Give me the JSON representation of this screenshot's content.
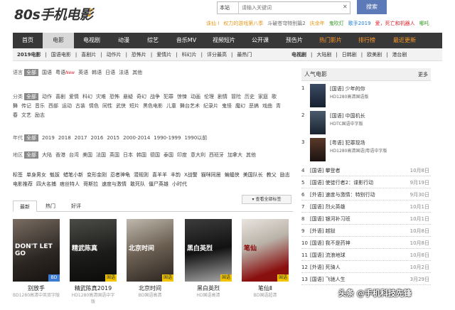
{
  "header": {
    "logo_text": "80s手机电影",
    "logo_glyph": "♪",
    "search_scope": "本站",
    "search_placeholder": "请输入关键词",
    "clear_glyph": "✕",
    "search_button": "搜索",
    "hotlinks": [
      {
        "text": "诛仙 Ⅰ",
        "color": "#e69a1a"
      },
      {
        "text": "权力的游戏第八季",
        "color": "#e69a1a"
      },
      {
        "text": "斗破苍穹特别篇2",
        "color": "#666666"
      },
      {
        "text": "庆余年",
        "color": "#e69a1a"
      },
      {
        "text": "鬼吹灯",
        "color": "#3a9a2a"
      },
      {
        "text": "歌手2019",
        "color": "#1a7ad0"
      },
      {
        "text": "爱，死亡和机器人",
        "color": "#e0232d"
      },
      {
        "text": "哪吒",
        "color": "#3a9a2a"
      }
    ]
  },
  "nav": {
    "items": [
      {
        "label": "首页"
      },
      {
        "label": "电影"
      },
      {
        "label": "电视剧"
      },
      {
        "label": "动漫"
      },
      {
        "label": "综艺"
      },
      {
        "label": "音乐MV"
      },
      {
        "label": "视频短片"
      },
      {
        "label": "公开课"
      },
      {
        "label": "预告片"
      },
      {
        "label": "热门影片"
      },
      {
        "label": "排行榜"
      },
      {
        "label": "最近更新"
      }
    ],
    "sub_left": [
      "2019电影",
      "国语电影",
      "喜剧片",
      "动作片",
      "恐怖片",
      "爱情片",
      "科幻片",
      "评分最高",
      "最热门"
    ],
    "sub_right": [
      "电视剧",
      "大陆剧",
      "日韩剧",
      "欧美剧",
      "港台剧"
    ]
  },
  "filters": {
    "language": {
      "label": "语言",
      "options": [
        "全部",
        "国语",
        "粤语",
        "英语",
        "韩语",
        "日语",
        "法语",
        "其他"
      ],
      "new_tag": "New"
    },
    "genre": {
      "label": "分类",
      "options": [
        "全部",
        "动作",
        "喜剧",
        "爱情",
        "科幻",
        "灾难",
        "恐怖",
        "悬疑",
        "奇幻",
        "战争",
        "犯罪",
        "惊悚",
        "动画",
        "伦理",
        "剧情",
        "冒险",
        "历史",
        "家庭",
        "歌舞",
        "传记",
        "音乐",
        "西部",
        "运动",
        "古装",
        "情色",
        "同性",
        "武侠",
        "短片",
        "黑色电影",
        "儿童",
        "舞台艺术",
        "纪录片",
        "鬼怪",
        "魔幻",
        "恶搞",
        "戏曲",
        "青春",
        "文艺",
        "励志"
      ]
    },
    "year": {
      "label": "年代",
      "options": [
        "全部",
        "2019",
        "2018",
        "2017",
        "2016",
        "2015",
        "2000-2014",
        "1990-1999",
        "1990以前"
      ]
    },
    "region": {
      "label": "地区",
      "options": [
        "全部",
        "大陆",
        "香港",
        "台湾",
        "美国",
        "法国",
        "英国",
        "日本",
        "韩国",
        "德国",
        "泰国",
        "印度",
        "意大利",
        "西班牙",
        "加拿大",
        "其他"
      ]
    }
  },
  "tags": {
    "label": "标签",
    "items": [
      "单身男女",
      "魁拔",
      "蜡笔小新",
      "变形金刚",
      "忍者神龟",
      "潜规则",
      "喜羊羊",
      "丰韵",
      "X战警",
      "猫咪同居",
      "蝙蝠侠",
      "美国队长",
      "教父",
      "励志电影推荐",
      "四大名捕",
      "痞丝特人",
      "哥斯拉",
      "速度与激情",
      "敢死队",
      "僵尸英雄",
      "小时代"
    ],
    "more": "查看全部标签"
  },
  "tabs": [
    "最新",
    "热门",
    "好评"
  ],
  "movies": [
    {
      "name": "别放手",
      "desc": "BD1280高清中英双字版",
      "badge": "BD",
      "poster_text": "DON'T LET GO"
    },
    {
      "name": "精武陈真2019",
      "desc": "HD1280高清国语中字版",
      "badge": "国语",
      "poster_text": "精武陈真"
    },
    {
      "name": "北京时间",
      "desc": "BD国语高清",
      "badge": "国语",
      "poster_text": "北京时间"
    },
    {
      "name": "黑白英烈",
      "desc": "HD国语高清",
      "badge": "国语",
      "poster_text": "黑白英烈"
    },
    {
      "name": "笔仙Ⅱ",
      "desc": "BD国语超清",
      "badge": "国语",
      "poster_text": "笔仙"
    }
  ],
  "sidebar": {
    "title": "人气电影",
    "more": "更多",
    "featured": [
      {
        "num": "1",
        "title": "[国语] 少年的你",
        "sub": "HD1280高清国语版"
      },
      {
        "num": "2",
        "title": "[国语] 中国机长",
        "sub": "HDTC国语中字版"
      },
      {
        "num": "3",
        "title": "[粤语] 犯罪现场",
        "sub": "HD1280高清国语|粤语中字版"
      }
    ],
    "list": [
      {
        "num": "4",
        "title": "[国语] 攀登者",
        "date": "10月8日"
      },
      {
        "num": "5",
        "title": "[国语] 使徒行者2：谍影行动",
        "date": "9月19日"
      },
      {
        "num": "6",
        "title": "[外语] 速度与激情：特别行动",
        "date": "9月30日"
      },
      {
        "num": "7",
        "title": "[国语] 烈火英雄",
        "date": "10月1日"
      },
      {
        "num": "8",
        "title": "[国语] 银河补习班",
        "date": "10月1日"
      },
      {
        "num": "9",
        "title": "[外语] 越狱",
        "date": "10月8日"
      },
      {
        "num": "10",
        "title": "[国语] 我不是药神",
        "date": "10月8日"
      },
      {
        "num": "11",
        "title": "[国语] 流浪地球",
        "date": "10月8日"
      },
      {
        "num": "12",
        "title": "[外语] 死骑人",
        "date": "10月2日"
      },
      {
        "num": "13",
        "title": "[国语] 飞驰人生",
        "date": "3月29日"
      }
    ]
  },
  "watermark": "头条 @手机科技先锋"
}
